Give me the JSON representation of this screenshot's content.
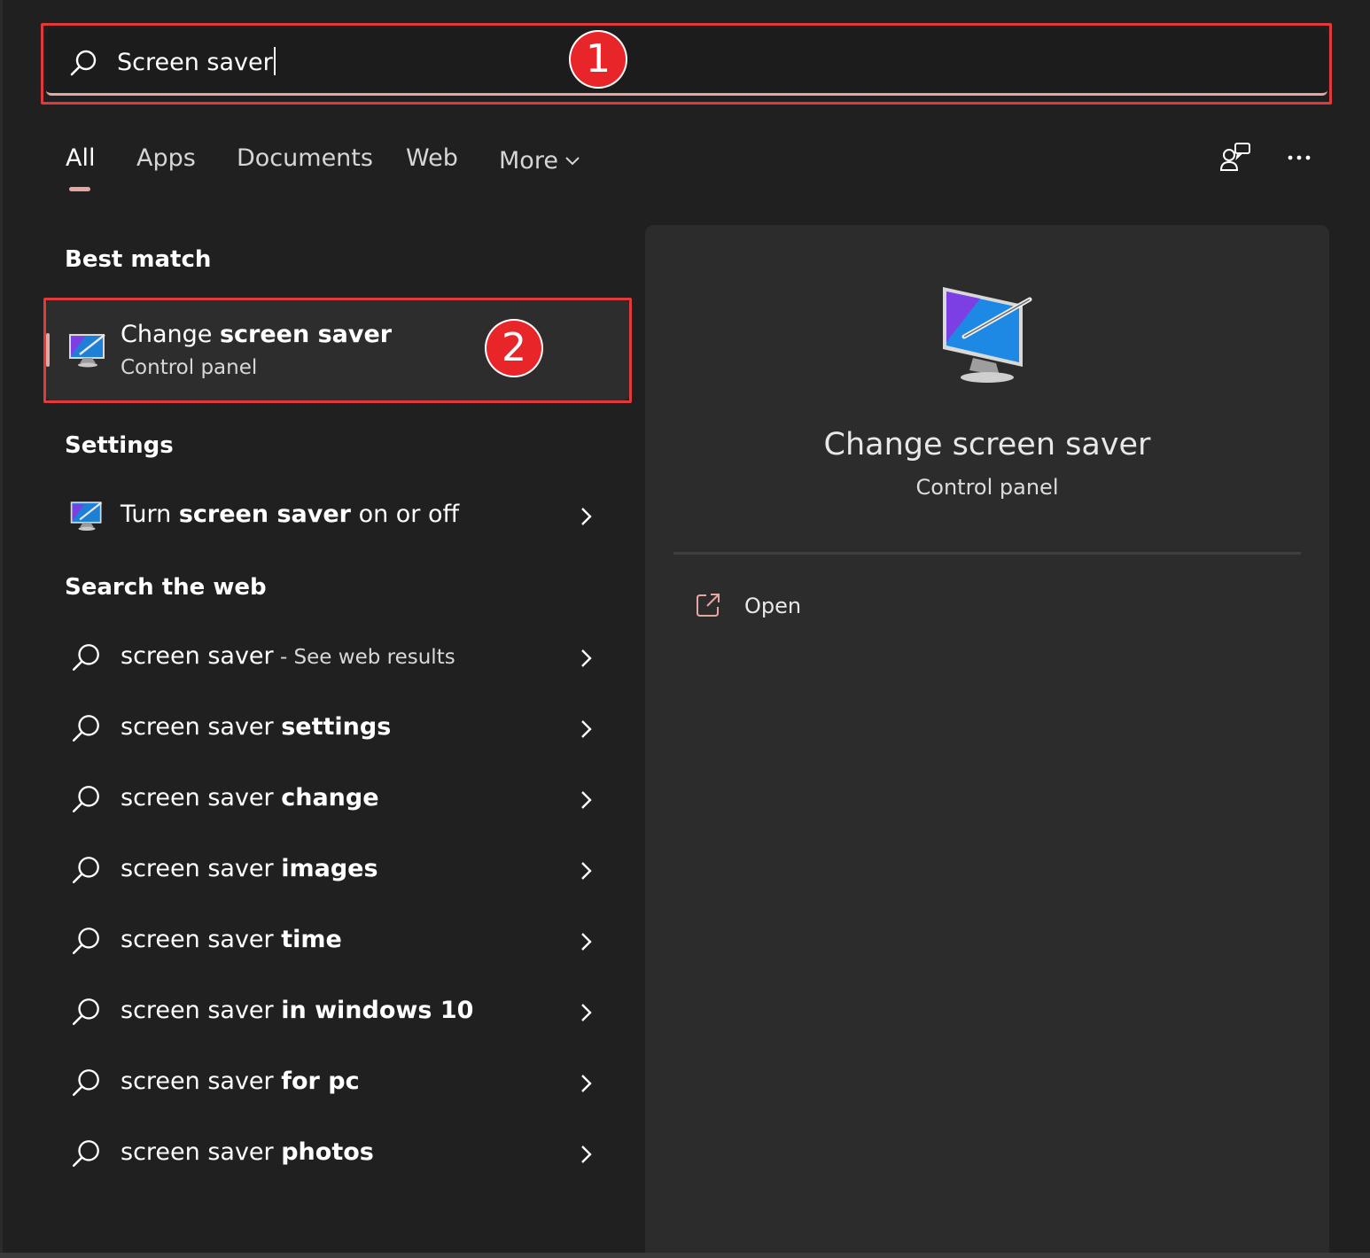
{
  "search": {
    "query": "Screen saver",
    "annotation_1": "1"
  },
  "tabs": [
    {
      "label": "All",
      "active": true
    },
    {
      "label": "Apps"
    },
    {
      "label": "Documents"
    },
    {
      "label": "Web"
    },
    {
      "label": "More"
    }
  ],
  "toolbar": {
    "feedback_icon": "people-chat-icon",
    "more_icon": "ellipsis-icon"
  },
  "best_match": {
    "section_title": "Best match",
    "title_plain": "Change ",
    "title_bold": "screen saver",
    "subtitle": "Control panel",
    "icon": "monitor-screensaver-icon",
    "annotation_2": "2"
  },
  "settings": {
    "section_title": "Settings",
    "item": {
      "pre": "Turn ",
      "bold": "screen saver",
      "post": " on or off"
    }
  },
  "web": {
    "section_title": "Search the web",
    "items": [
      {
        "plain": "screen saver",
        "bold": "",
        "hint": " - See web results"
      },
      {
        "plain": "screen saver ",
        "bold": "settings",
        "hint": ""
      },
      {
        "plain": "screen saver ",
        "bold": "change",
        "hint": ""
      },
      {
        "plain": "screen saver ",
        "bold": "images",
        "hint": ""
      },
      {
        "plain": "screen saver ",
        "bold": "time",
        "hint": ""
      },
      {
        "plain": "screen saver ",
        "bold": "in windows 10",
        "hint": ""
      },
      {
        "plain": "screen saver ",
        "bold": "for pc",
        "hint": ""
      },
      {
        "plain": "screen saver ",
        "bold": "photos",
        "hint": ""
      }
    ]
  },
  "preview": {
    "title": "Change screen saver",
    "subtitle": "Control panel",
    "open_label": "Open"
  },
  "colors": {
    "background": "#202020",
    "panel": "#2c2c2c",
    "accent": "#e4a7a1",
    "annotation_red": "#e8262a"
  }
}
